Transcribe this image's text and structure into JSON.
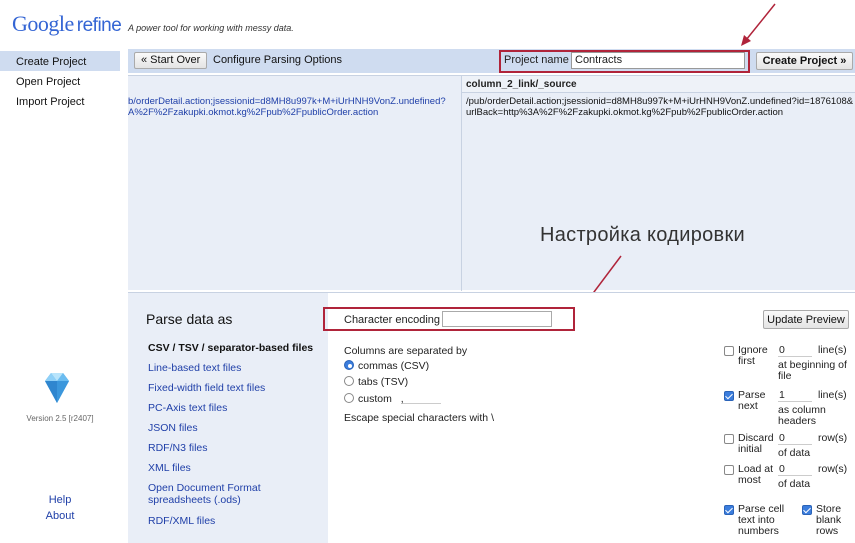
{
  "header": {
    "logo_google": "Google",
    "logo_refine": "refine",
    "tagline": "A power tool for working with messy data."
  },
  "sidebar": {
    "items": [
      {
        "label": "Create Project",
        "active": true
      },
      {
        "label": "Open Project",
        "active": false
      },
      {
        "label": "Import Project",
        "active": false
      }
    ],
    "version": "Version 2.5 [r2407]",
    "help": "Help",
    "about": "About"
  },
  "toolbar": {
    "start_over": "« Start Over",
    "title": "Configure Parsing Options",
    "project_name_label": "Project name",
    "project_name_value": "Contracts",
    "create_project": "Create Project »"
  },
  "preview": {
    "column_header": "column_2_link/_source",
    "left_cell": "b/orderDetail.action;jsessionid=d8MH8u997k+M+iUrHNH9VonZ.undefined?A%2F%2Fzakupki.okmot.kg%2Fpub%2FpublicOrder.action",
    "right_cell": "/pub/orderDetail.action;jsessionid=d8MH8u997k+M+iUrHNH9VonZ.undefined?id=1876108&urlBack=http%3A%2F%2Fzakupki.okmot.kg%2Fpub%2FpublicOrder.action",
    "annotation": "Настройка кодировки"
  },
  "parse": {
    "title": "Parse data as",
    "formats": [
      {
        "label": "CSV / TSV / separator-based files",
        "active": true
      },
      {
        "label": "Line-based text files",
        "active": false
      },
      {
        "label": "Fixed-width field text files",
        "active": false
      },
      {
        "label": "PC-Axis text files",
        "active": false
      },
      {
        "label": "JSON files",
        "active": false
      },
      {
        "label": "RDF/N3 files",
        "active": false
      },
      {
        "label": "XML files",
        "active": false
      },
      {
        "label": "Open Document Format spreadsheets (.ods)",
        "active": false
      },
      {
        "label": "RDF/XML files",
        "active": false
      }
    ],
    "encoding_label": "Character encoding",
    "encoding_value": "",
    "update_preview": "Update Preview",
    "separator_title": "Columns are separated by",
    "separators": [
      {
        "label": "commas (CSV)",
        "checked": true
      },
      {
        "label": "tabs (TSV)",
        "checked": false
      },
      {
        "label": "custom",
        "checked": false
      }
    ],
    "custom_value": ",",
    "escape": "Escape special characters with \\",
    "ignore": {
      "checked": false,
      "label1": "Ignore",
      "label2": "first",
      "value": "0",
      "unit": "line(s)",
      "tail": "at beginning of file"
    },
    "parse_next": {
      "checked": true,
      "label1": "Parse",
      "label2": "next",
      "value": "1",
      "unit": "line(s)",
      "tail": "as column headers"
    },
    "discard": {
      "checked": false,
      "label1": "Discard",
      "label2": "initial",
      "value": "0",
      "unit": "row(s)",
      "tail": "of data"
    },
    "load_at_most": {
      "checked": false,
      "label1": "Load at",
      "label2": "most",
      "value": "0",
      "unit": "row(s)",
      "tail": "of data"
    },
    "parse_cell": {
      "checked": true,
      "label": "Parse cell text into numbers"
    },
    "store_blank": {
      "checked": true,
      "label": "Store blank rows"
    }
  },
  "colors": {
    "accent": "#cfdcf0",
    "link": "#1f3fa8",
    "highlight": "#b0243a"
  }
}
